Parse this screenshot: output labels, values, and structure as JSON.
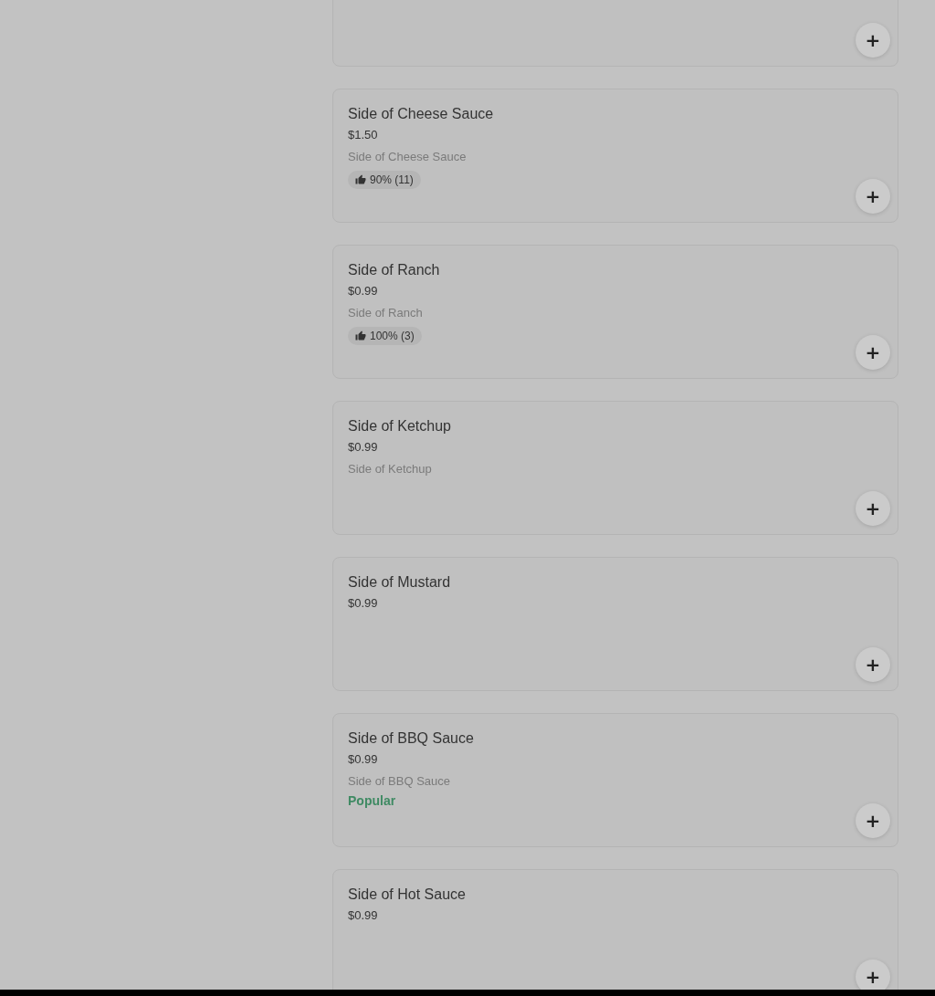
{
  "menu_items": [
    {
      "add_button": "+"
    },
    {
      "name": "Side of Cheese Sauce",
      "price": "$1.50",
      "description": "Side of Cheese Sauce",
      "rating": "90% (11)",
      "add_button": "+"
    },
    {
      "name": "Side of Ranch",
      "price": "$0.99",
      "description": "Side of Ranch",
      "rating": "100% (3)",
      "add_button": "+"
    },
    {
      "name": "Side of Ketchup",
      "price": "$0.99",
      "description": "Side of Ketchup",
      "add_button": "+"
    },
    {
      "name": "Side of Mustard",
      "price": "$0.99",
      "add_button": "+"
    },
    {
      "name": "Side of BBQ Sauce",
      "price": "$0.99",
      "description": "Side of BBQ Sauce",
      "tag": "Popular",
      "add_button": "+"
    },
    {
      "name": "Side of Hot Sauce",
      "price": "$0.99",
      "add_button": "+"
    }
  ]
}
